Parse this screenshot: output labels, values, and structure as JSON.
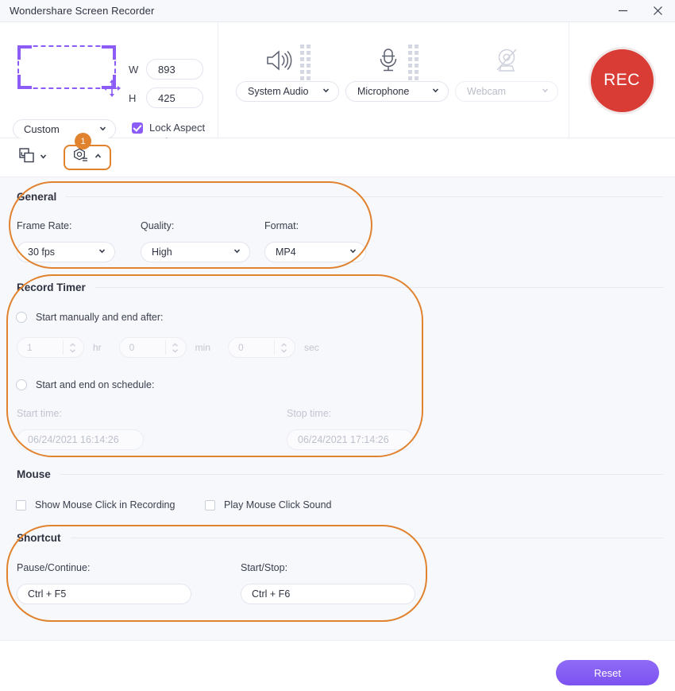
{
  "window": {
    "title": "Wondershare Screen Recorder",
    "minimize_label": "minimize",
    "close_label": "close"
  },
  "capture": {
    "width_label": "W",
    "width_value": "893",
    "height_label": "H",
    "height_value": "425",
    "preset_value": "Custom",
    "lock_aspect_label": "Lock Aspect Ratio",
    "lock_aspect_checked": true,
    "region_icon": "selection-rectangle-icon",
    "move_icon": "move-cursor-icon"
  },
  "sources": {
    "system_audio": {
      "icon": "speaker-icon",
      "label": "System Audio",
      "enabled": true
    },
    "microphone": {
      "icon": "microphone-icon",
      "label": "Microphone",
      "enabled": true
    },
    "webcam": {
      "icon": "webcam-off-icon",
      "label": "Webcam",
      "enabled": false
    }
  },
  "record_button": {
    "label": "REC",
    "color": "#d93b35"
  },
  "toolbar": {
    "capture_mode": {
      "icon": "screen-region-icon",
      "caret": "chevron-down-icon"
    },
    "settings": {
      "icon": "settings-gear-icon",
      "caret": "chevron-up-icon",
      "badge": "1"
    }
  },
  "general": {
    "title": "General",
    "frame_rate_label": "Frame Rate:",
    "frame_rate_value": "30 fps",
    "quality_label": "Quality:",
    "quality_value": "High",
    "format_label": "Format:",
    "format_value": "MP4"
  },
  "record_timer": {
    "title": "Record Timer",
    "manual_option_label": "Start manually and end after:",
    "manual_selected": false,
    "hr_value": "1",
    "hr_unit": "hr",
    "min_value": "0",
    "min_unit": "min",
    "sec_value": "0",
    "sec_unit": "sec",
    "schedule_option_label": "Start and end on schedule:",
    "schedule_selected": false,
    "start_time_label": "Start time:",
    "start_time_value": "06/24/2021 16:14:26",
    "stop_time_label": "Stop time:",
    "stop_time_value": "06/24/2021 17:14:26"
  },
  "mouse": {
    "title": "Mouse",
    "show_click_label": "Show Mouse Click in Recording",
    "show_click_checked": false,
    "play_sound_label": "Play Mouse Click Sound",
    "play_sound_checked": false
  },
  "shortcut": {
    "title": "Shortcut",
    "pause_label": "Pause/Continue:",
    "pause_value": "Ctrl + F5",
    "startstop_label": "Start/Stop:",
    "startstop_value": "Ctrl + F6"
  },
  "footer": {
    "reset_label": "Reset"
  },
  "colors": {
    "accent_purple": "#8b5cf6",
    "annotation_orange": "#e0822e",
    "record_red": "#d93b35",
    "panel_bg": "#f7f8fc"
  }
}
